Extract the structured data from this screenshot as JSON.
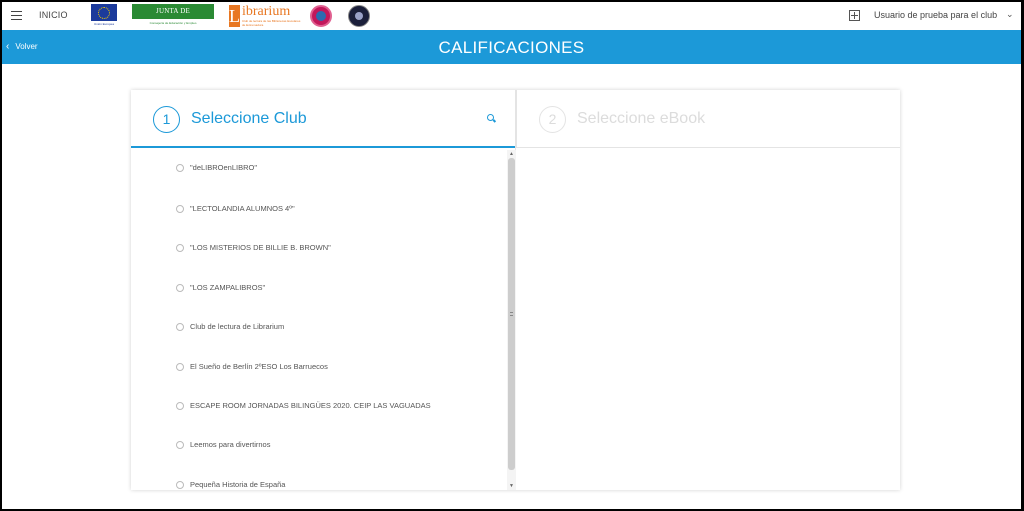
{
  "topbar": {
    "menu_icon": "hamburger-icon",
    "inicio": "INICIO",
    "logos": {
      "eu_caption": "Unión Europea",
      "junta_title": "JUNTA DE EXTREMADURA",
      "junta_subtitle": "Consejería de Educación y Empleo",
      "librarium_letter": "L",
      "librarium_text": "ibrarium",
      "librarium_subtitle": "Club de lectura de las Bibliotecas Escolares de Extremadura"
    },
    "add_icon": "plus-square-icon",
    "user": "Usuario de prueba para el club",
    "user_caret": "⌄"
  },
  "header": {
    "back": "Volver",
    "back_icon": "chevron-left-icon",
    "title": "CALIFICACIONES",
    "color": "#1c99d8"
  },
  "steps": [
    {
      "number": "1",
      "label": "Seleccione Club",
      "active": true
    },
    {
      "number": "2",
      "label": "Seleccione eBook",
      "active": false
    }
  ],
  "clubs": [
    "\"deLIBROenLIBRO\"",
    "\"LECTOLANDIA ALUMNOS 4º\"",
    "\"LOS MISTERIOS DE BILLIE B. BROWN\"",
    "\"LOS ZAMPALIBROS\"",
    "Club de lectura de Librarium",
    "El Sueño de Berlín 2ºESO Los Barruecos",
    "ESCAPE ROOM JORNADAS BILINGÜES 2020. CEIP LAS VAGUADAS",
    "Leemos para divertirnos",
    "Pequeña Historia de España"
  ]
}
